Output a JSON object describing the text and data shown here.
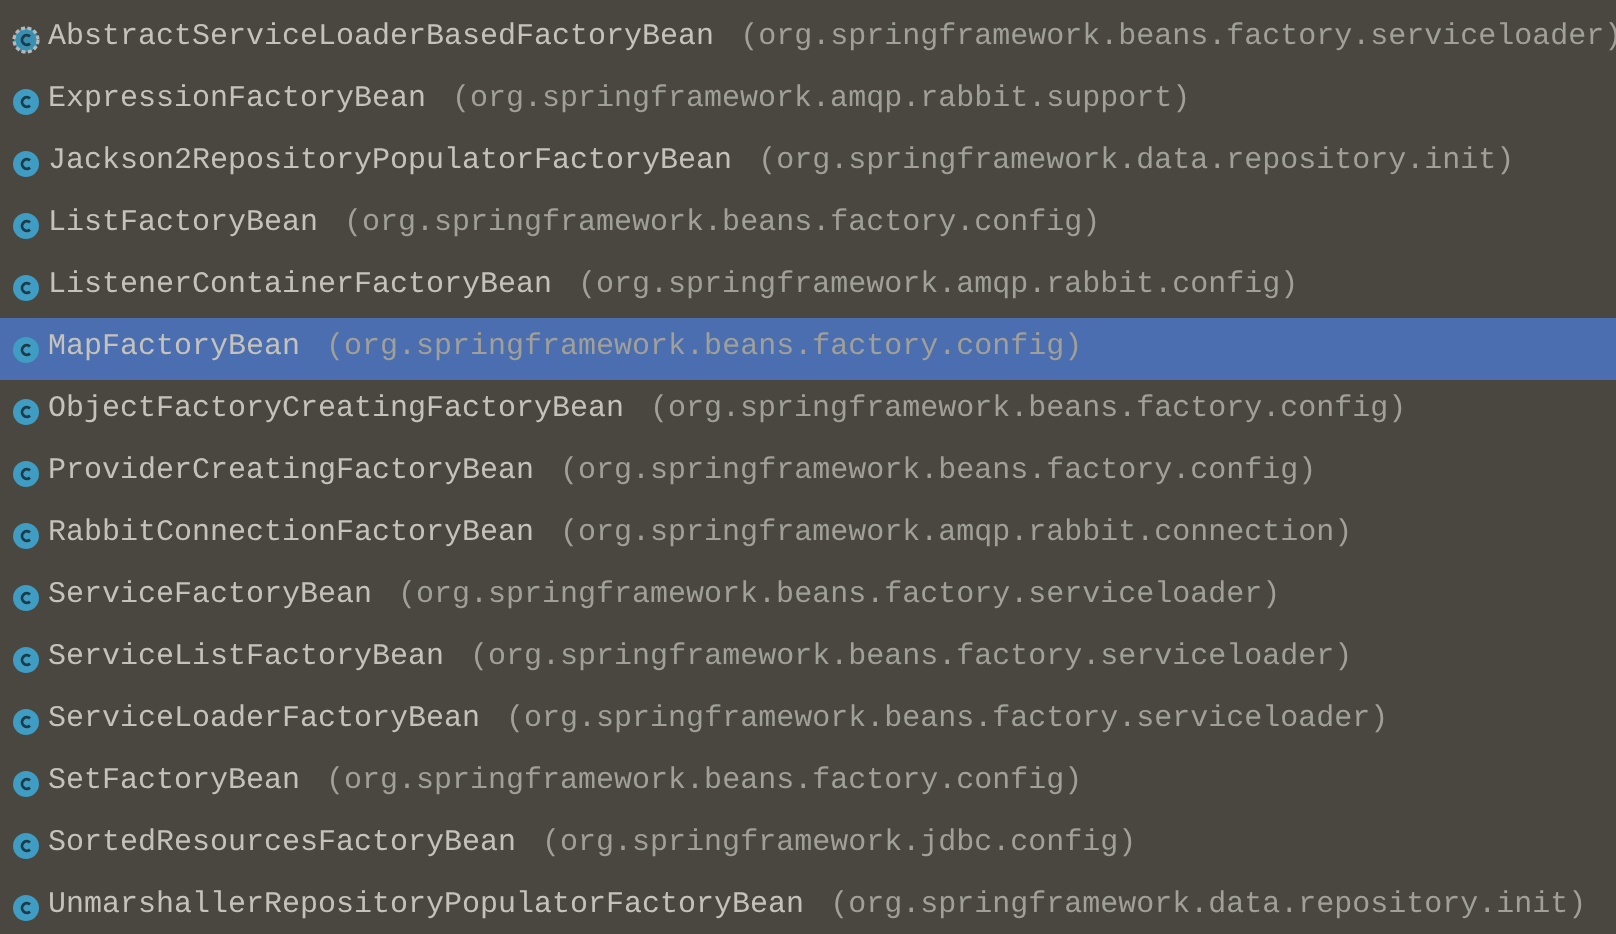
{
  "items": [
    {
      "name": "AbstractServiceLoaderBasedFactoryBean",
      "package": "(org.springframework.beans.factory.serviceloader)",
      "kind": "abstract",
      "selected": false
    },
    {
      "name": "ExpressionFactoryBean",
      "package": "(org.springframework.amqp.rabbit.support)",
      "kind": "class",
      "selected": false
    },
    {
      "name": "Jackson2RepositoryPopulatorFactoryBean",
      "package": "(org.springframework.data.repository.init)",
      "kind": "class",
      "selected": false
    },
    {
      "name": "ListFactoryBean",
      "package": "(org.springframework.beans.factory.config)",
      "kind": "class",
      "selected": false
    },
    {
      "name": "ListenerContainerFactoryBean",
      "package": "(org.springframework.amqp.rabbit.config)",
      "kind": "class",
      "selected": false
    },
    {
      "name": "MapFactoryBean",
      "package": "(org.springframework.beans.factory.config)",
      "kind": "class",
      "selected": true
    },
    {
      "name": "ObjectFactoryCreatingFactoryBean",
      "package": "(org.springframework.beans.factory.config)",
      "kind": "class",
      "selected": false
    },
    {
      "name": "ProviderCreatingFactoryBean",
      "package": "(org.springframework.beans.factory.config)",
      "kind": "class",
      "selected": false
    },
    {
      "name": "RabbitConnectionFactoryBean",
      "package": "(org.springframework.amqp.rabbit.connection)",
      "kind": "class",
      "selected": false
    },
    {
      "name": "ServiceFactoryBean",
      "package": "(org.springframework.beans.factory.serviceloader)",
      "kind": "class",
      "selected": false
    },
    {
      "name": "ServiceListFactoryBean",
      "package": "(org.springframework.beans.factory.serviceloader)",
      "kind": "class",
      "selected": false
    },
    {
      "name": "ServiceLoaderFactoryBean",
      "package": "(org.springframework.beans.factory.serviceloader)",
      "kind": "class",
      "selected": false
    },
    {
      "name": "SetFactoryBean",
      "package": "(org.springframework.beans.factory.config)",
      "kind": "class",
      "selected": false
    },
    {
      "name": "SortedResourcesFactoryBean",
      "package": "(org.springframework.jdbc.config)",
      "kind": "class",
      "selected": false
    },
    {
      "name": "UnmarshallerRepositoryPopulatorFactoryBean",
      "package": "(org.springframework.data.repository.init)",
      "kind": "class",
      "selected": false
    }
  ]
}
